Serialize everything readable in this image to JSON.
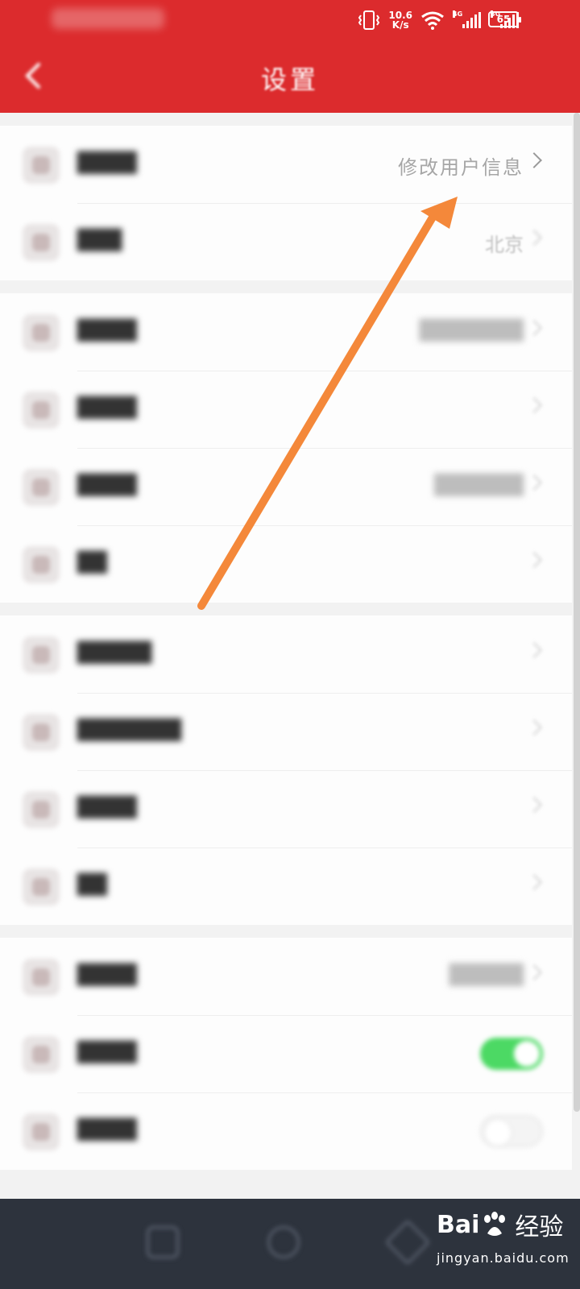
{
  "status_bar": {
    "net_speed_value": "10.6",
    "net_speed_unit": "K/s",
    "sim1_tag": "4G",
    "sim2_tag": "5G",
    "battery": "65"
  },
  "header": {
    "title": "设置",
    "back_icon": "chevron-left-icon",
    "background_color": "#dc2b2d"
  },
  "rows": {
    "user_info": {
      "value": "修改用户信息"
    },
    "city": {
      "value": "北京"
    },
    "switch_on": {
      "color": "#4cd964"
    }
  },
  "annotation": {
    "arrow_color": "#f4883a"
  },
  "watermark": {
    "logo_left": "Bai",
    "logo_right": "经验",
    "url": "jingyan.baidu.com"
  }
}
